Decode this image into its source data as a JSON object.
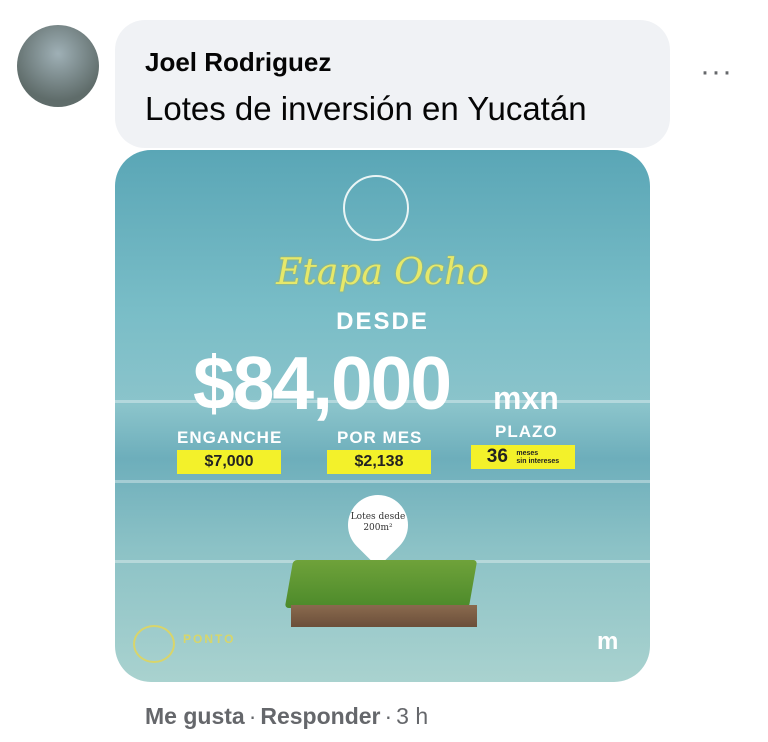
{
  "comment": {
    "author": "Joel Rodriguez",
    "text": "Lotes de inversión en Yucatán",
    "more_icon": "···"
  },
  "ad": {
    "title": "Etapa Ocho",
    "desde": "DESDE",
    "price": "$84,000",
    "currency": "mxn",
    "enganche_label": "ENGANCHE",
    "enganche_value": "$7,000",
    "por_mes_label": "POR MES",
    "por_mes_value": "$2,138",
    "plazo_label": "PLAZO",
    "plazo_value": "36",
    "plazo_unit": "meses",
    "plazo_note": "sin intereses",
    "pin_line1": "Lotes desde",
    "pin_line2": "200m²",
    "brand": "PONTO",
    "brand_mark": "m"
  },
  "actions": {
    "like": "Me gusta",
    "reply": "Responder",
    "time": "3 h"
  }
}
